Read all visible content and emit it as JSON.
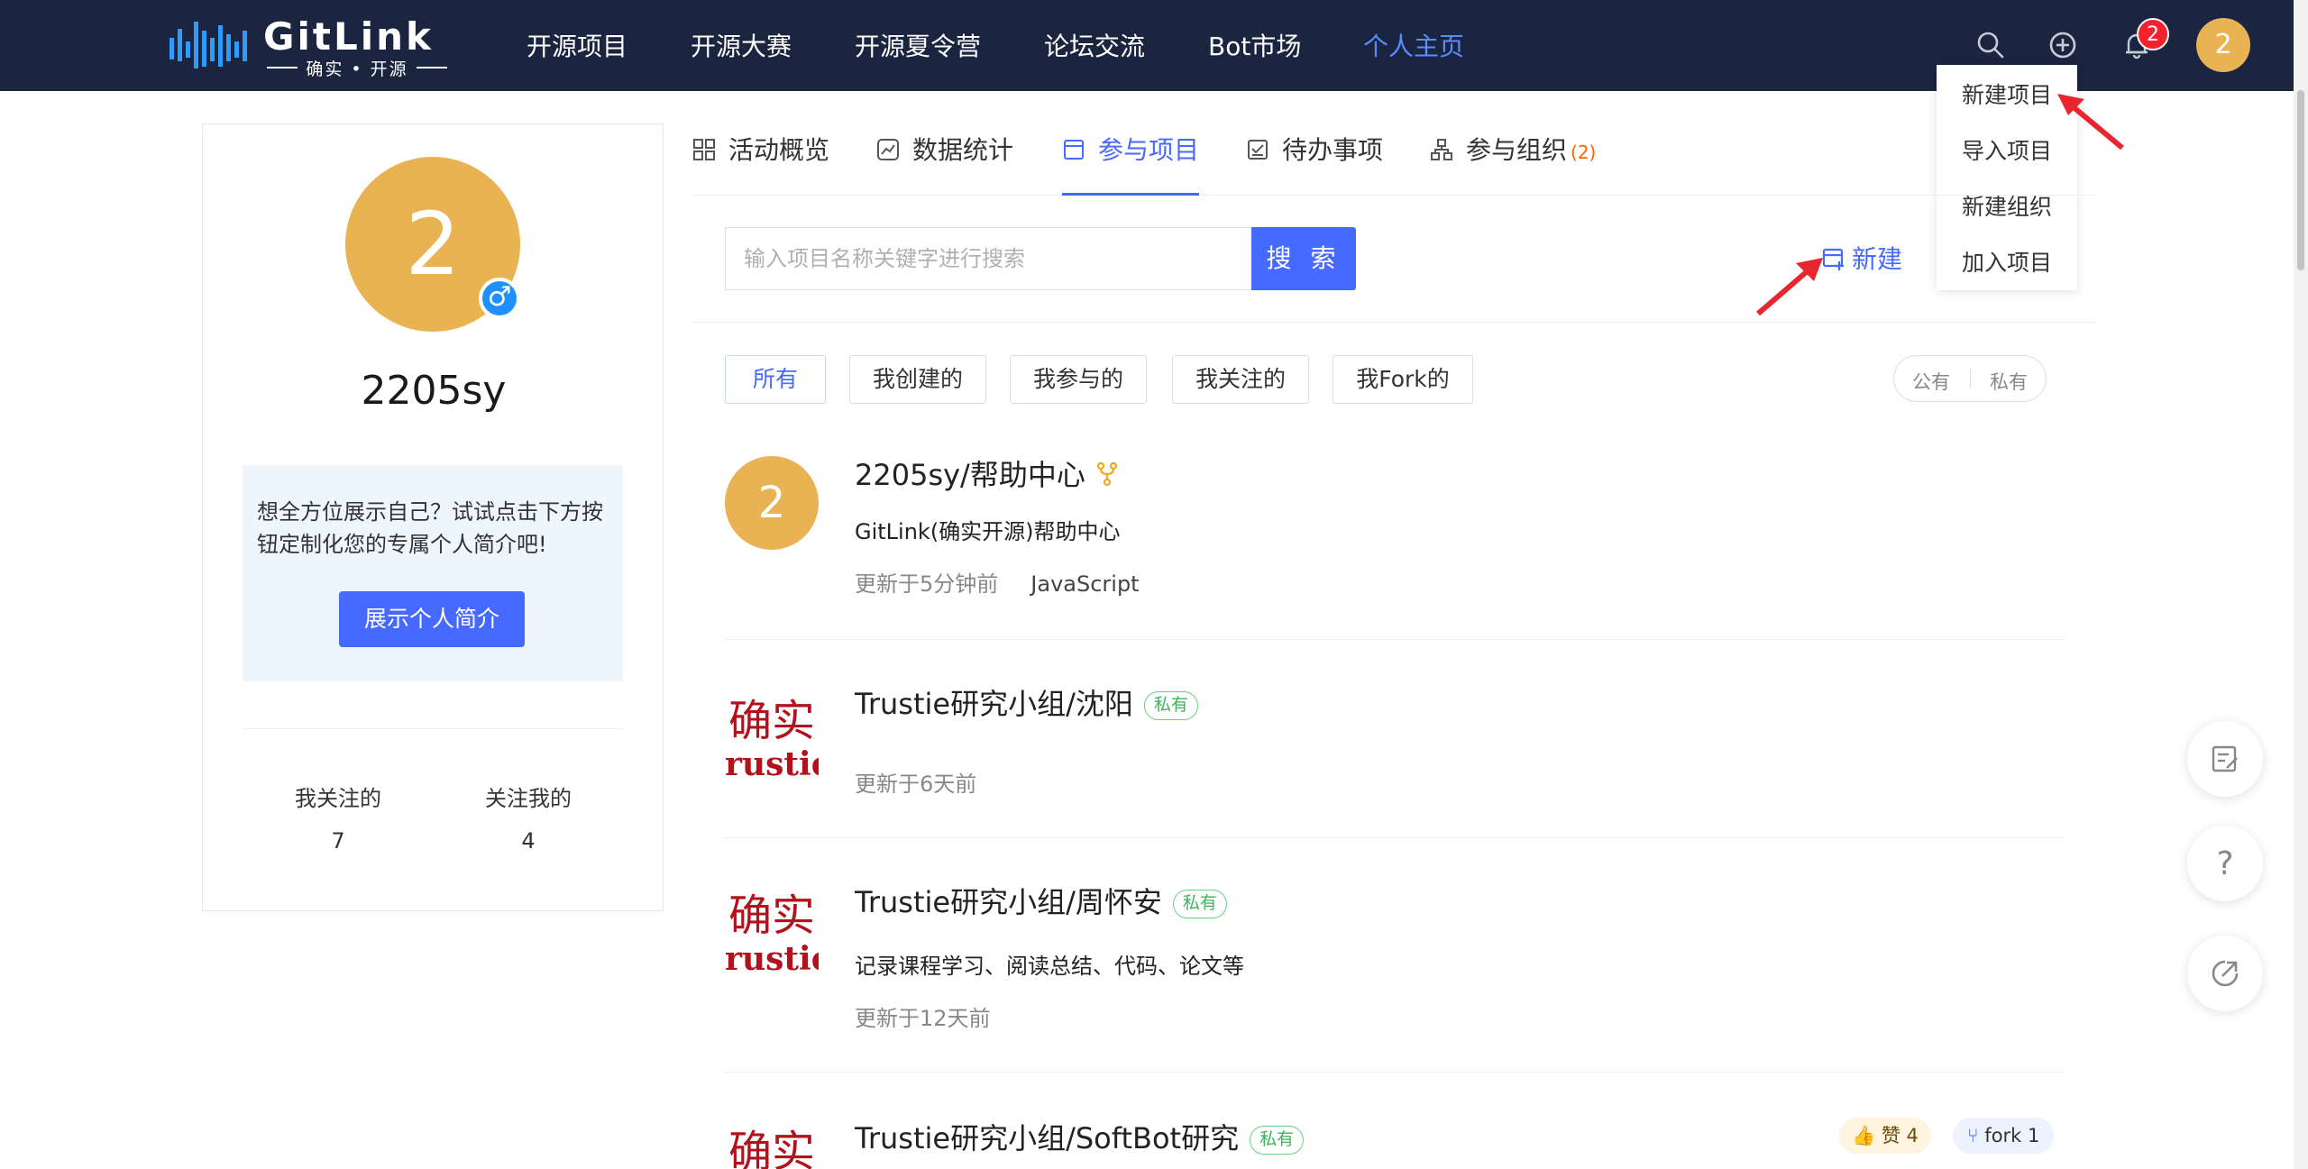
{
  "brand": {
    "name": "GitLink",
    "subtitle": "确实 • 开源"
  },
  "nav": {
    "items": [
      "开源项目",
      "开源大赛",
      "开源夏令营",
      "论坛交流",
      "Bot市场",
      "个人主页"
    ],
    "active": "个人主页",
    "notification_count": "2",
    "user_avatar_text": "2"
  },
  "create_menu": {
    "items": [
      "新建项目",
      "导入项目",
      "新建组织",
      "加入项目"
    ]
  },
  "profile": {
    "avatar_text": "2",
    "username": "2205sy",
    "intro_prompt": "想全方位展示自己？试试点击下方按钮定制化您的专属个人简介吧!",
    "intro_button": "展示个人简介",
    "following_label": "我关注的",
    "following_count": "7",
    "followers_label": "关注我的",
    "followers_count": "4"
  },
  "tabs": {
    "items": [
      {
        "label": "活动概览",
        "icon": "grid-icon"
      },
      {
        "label": "数据统计",
        "icon": "chart-icon"
      },
      {
        "label": "参与项目",
        "icon": "project-icon"
      },
      {
        "label": "待办事项",
        "icon": "todo-icon"
      },
      {
        "label": "参与组织",
        "icon": "org-icon",
        "count": "(2)"
      }
    ],
    "active": "参与项目"
  },
  "search": {
    "placeholder": "输入项目名称关键字进行搜索",
    "button": "搜 索",
    "new_label": "新建"
  },
  "filters": {
    "items": [
      "所有",
      "我创建的",
      "我参与的",
      "我关注的",
      "我Fork的"
    ],
    "active": "所有",
    "visibility": [
      "公有",
      "私有"
    ]
  },
  "projects": [
    {
      "name": "2205sy/帮助中心",
      "avatar_text": "2",
      "forked": true,
      "description": "GitLink(确实开源)帮助中心",
      "updated": "更新于5分钟前",
      "language": "JavaScript"
    },
    {
      "name": "Trustie研究小组/沈阳",
      "private_label": "私有",
      "updated": "更新于6天前"
    },
    {
      "name": "Trustie研究小组/周怀安",
      "private_label": "私有",
      "description": "记录课程学习、阅读总结、代码、论文等",
      "updated": "更新于12天前"
    },
    {
      "name": "Trustie研究小组/SoftBot研究",
      "private_label": "私有",
      "likes": "赞 4",
      "forks": "fork 1"
    }
  ],
  "colors": {
    "nav_bg": "#1b2540",
    "accent": "#466aff",
    "avatar": "#e9b353",
    "private_badge": "#3fb25a",
    "badge_red": "#f5222d",
    "arrow_red": "#e8262d"
  }
}
